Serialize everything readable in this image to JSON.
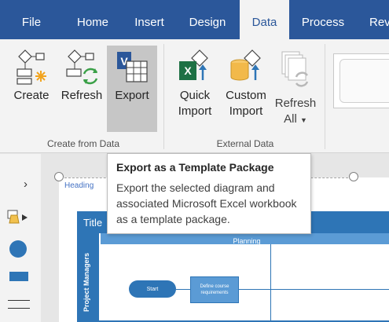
{
  "tabs": [
    "File",
    "Home",
    "Insert",
    "Design",
    "Data",
    "Process",
    "Revi"
  ],
  "active_tab": "Data",
  "ribbon": {
    "create_label": "Create",
    "refresh_label": "Refresh",
    "export_label": "Export",
    "quick_import_line1": "Quick",
    "quick_import_line2": "Import",
    "custom_import_line1": "Custom",
    "custom_import_line2": "Import",
    "refresh_all_line1": "Refresh",
    "refresh_all_line2": "All",
    "group_create": "Create from Data",
    "group_external": "External Data"
  },
  "tooltip": {
    "title": "Export as a Template Package",
    "body": "Export the selected diagram and associated Microsoft Excel workbook as a template package."
  },
  "diagram": {
    "heading": "Heading",
    "title": "Title",
    "phase": "Planning",
    "swimlane": "Project Managers",
    "start": "Start",
    "process": "Define course requirements"
  },
  "colors": {
    "tab_bar": "#2b579a",
    "ribbon_bg": "#f3f3f3",
    "shape_blue": "#2e75b6",
    "light_blue": "#5b9bd5"
  },
  "icons": {
    "chevron": "chevron-right-icon",
    "shapes_panel": "shapes-panel-icon"
  }
}
